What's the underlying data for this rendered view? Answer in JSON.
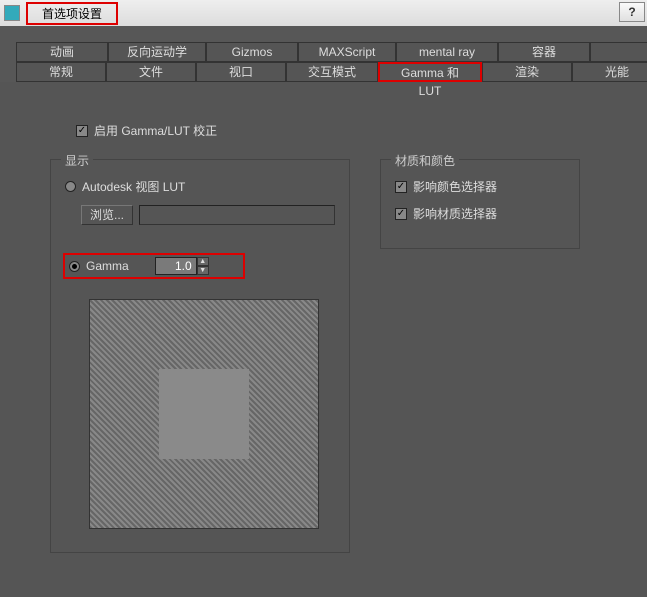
{
  "window": {
    "title": "首选项设置",
    "help_icon": "?"
  },
  "tabs_row1": [
    {
      "label": "动画"
    },
    {
      "label": "反向运动学"
    },
    {
      "label": "Gizmos"
    },
    {
      "label": "MAXScript"
    },
    {
      "label": "mental ray"
    },
    {
      "label": "容器"
    },
    {
      "label": ""
    }
  ],
  "tabs_row2": [
    {
      "label": "常规"
    },
    {
      "label": "文件"
    },
    {
      "label": "视口"
    },
    {
      "label": "交互模式"
    },
    {
      "label": "Gamma 和 LUT"
    },
    {
      "label": "渲染"
    },
    {
      "label": "光能"
    }
  ],
  "active_tab_index": 4,
  "enable": {
    "label": "启用 Gamma/LUT 校正"
  },
  "display_group": {
    "title": "显示",
    "radio_lut": "Autodesk 视图 LUT",
    "browse_btn": "浏览...",
    "path_value": "",
    "radio_gamma": "Gamma",
    "gamma_value": "1.0"
  },
  "material_group": {
    "title": "材质和颜色",
    "affect_color": "影响颜色选择器",
    "affect_material": "影响材质选择器"
  },
  "colors": {
    "highlight": "#d00"
  }
}
